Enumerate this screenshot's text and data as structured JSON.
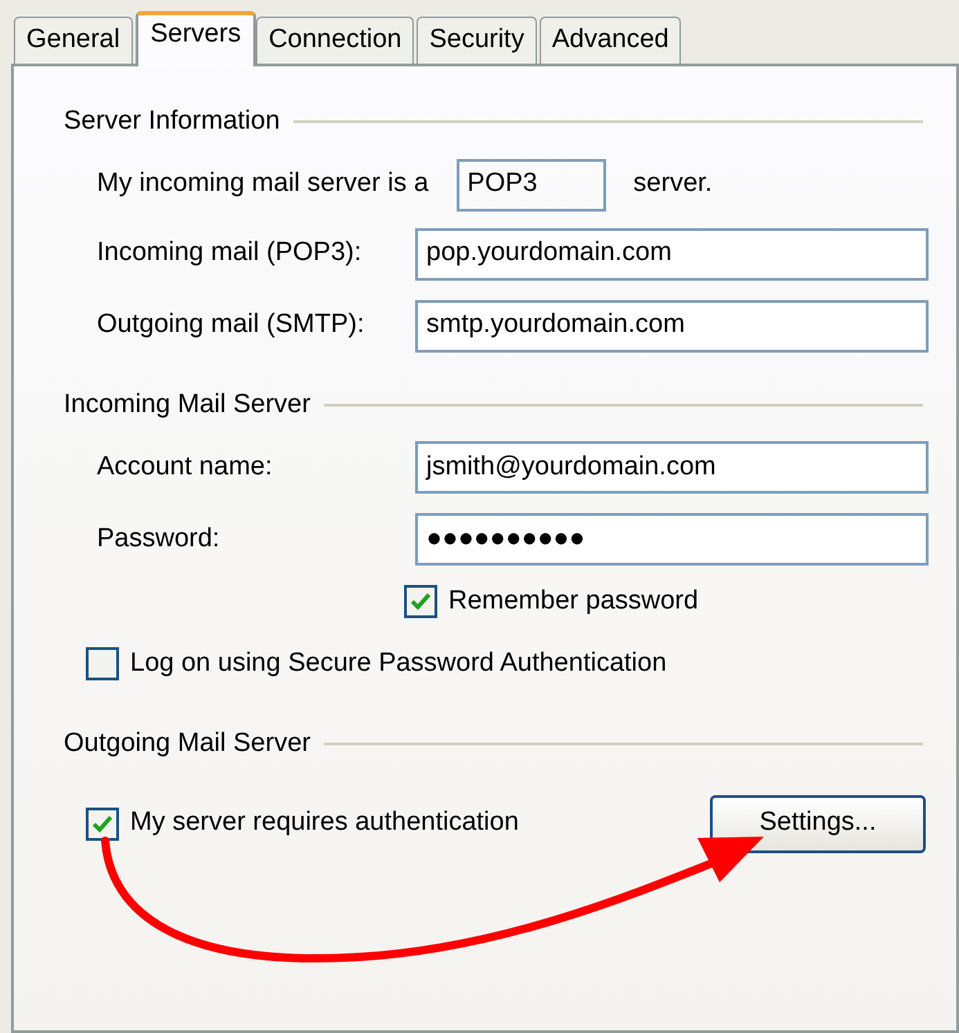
{
  "tabs": [
    {
      "label": "General",
      "selected": false
    },
    {
      "label": "Servers",
      "selected": true
    },
    {
      "label": "Connection",
      "selected": false
    },
    {
      "label": "Security",
      "selected": false
    },
    {
      "label": "Advanced",
      "selected": false
    }
  ],
  "server_information": {
    "title": "Server Information",
    "server_type": {
      "prefix": "My incoming mail server is a",
      "value": "POP3",
      "suffix": "server."
    },
    "fields": [
      {
        "label": "Incoming mail (POP3):",
        "value": "pop.yourdomain.com"
      },
      {
        "label": "Outgoing mail (SMTP):",
        "value": "smtp.yourdomain.com"
      }
    ]
  },
  "incoming_mail_server": {
    "title": "Incoming Mail Server",
    "fields": [
      {
        "label": "Account name:",
        "value": "jsmith@yourdomain.com"
      },
      {
        "label": "Password:",
        "value": "●●●●●●●●●●"
      }
    ],
    "remember_password": {
      "label": "Remember password",
      "checked": true
    },
    "secure_password_authentication": {
      "label": "Log on using Secure Password Authentication",
      "checked": false
    }
  },
  "outgoing_mail_server": {
    "title": "Outgoing Mail Server",
    "requires_authentication": {
      "label": "My server requires authentication",
      "checked": true
    },
    "settings_button": "Settings..."
  }
}
